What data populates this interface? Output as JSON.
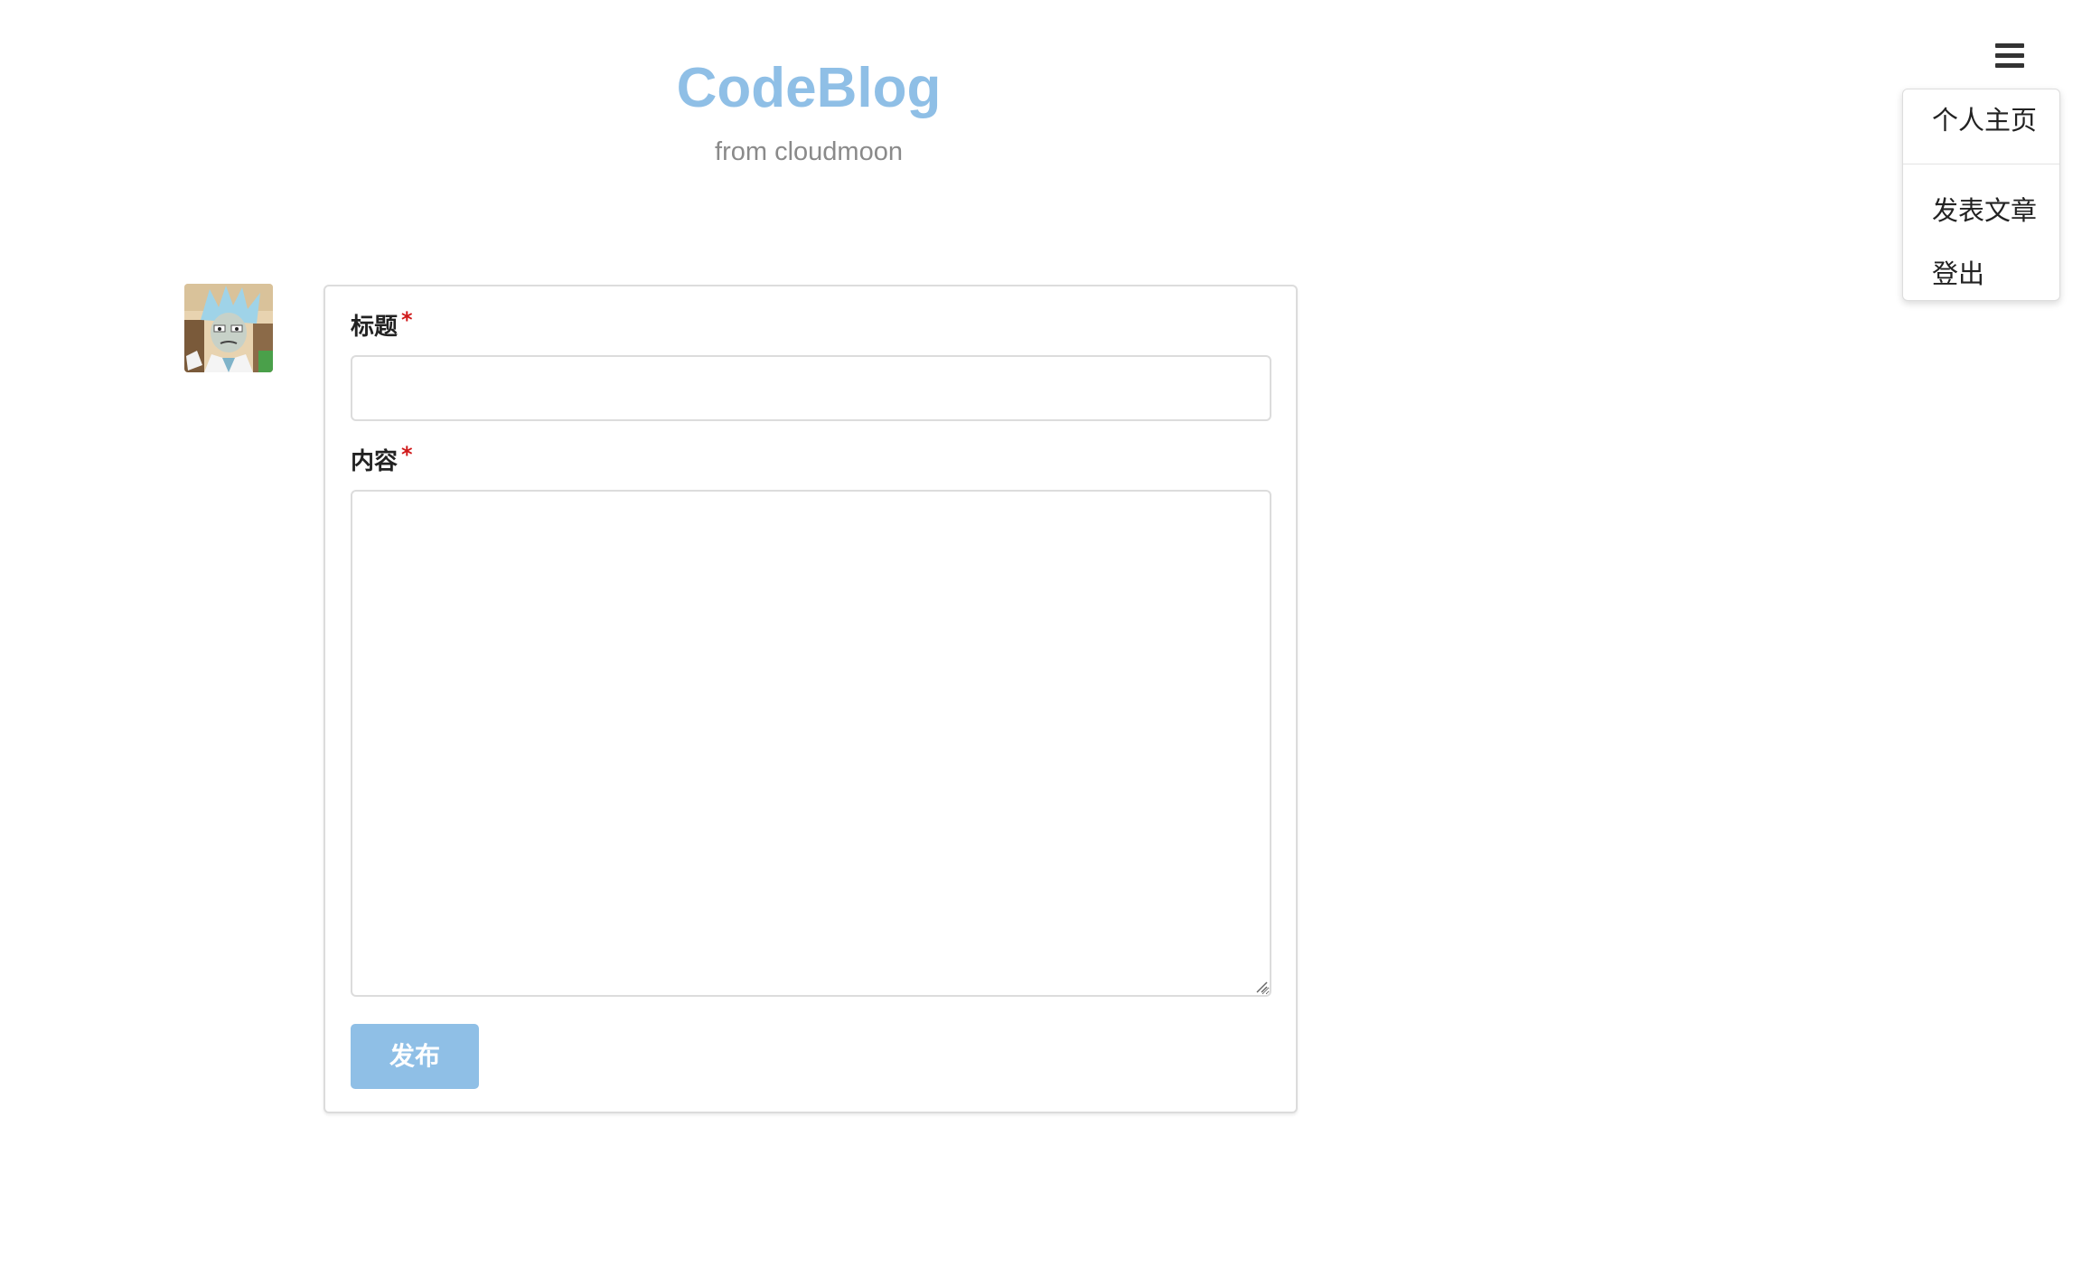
{
  "brand": {
    "title": "CodeBlog",
    "subtitle": "from cloudmoon",
    "color": "#8fbfe6"
  },
  "nav": {
    "toggle_icon": "hamburger-menu-icon",
    "menu_items": [
      {
        "label": "个人主页"
      },
      {
        "label": "发表文章"
      },
      {
        "label": "登出"
      }
    ]
  },
  "user": {
    "avatar_icon": "user-avatar-cartoon"
  },
  "form": {
    "title_label": "标题",
    "title_required_mark": "*",
    "title_value": "",
    "content_label": "内容",
    "content_required_mark": "*",
    "content_value": "",
    "submit_label": "发布",
    "submit_color": "#8fbfe6",
    "required_color": "#d0191a"
  }
}
